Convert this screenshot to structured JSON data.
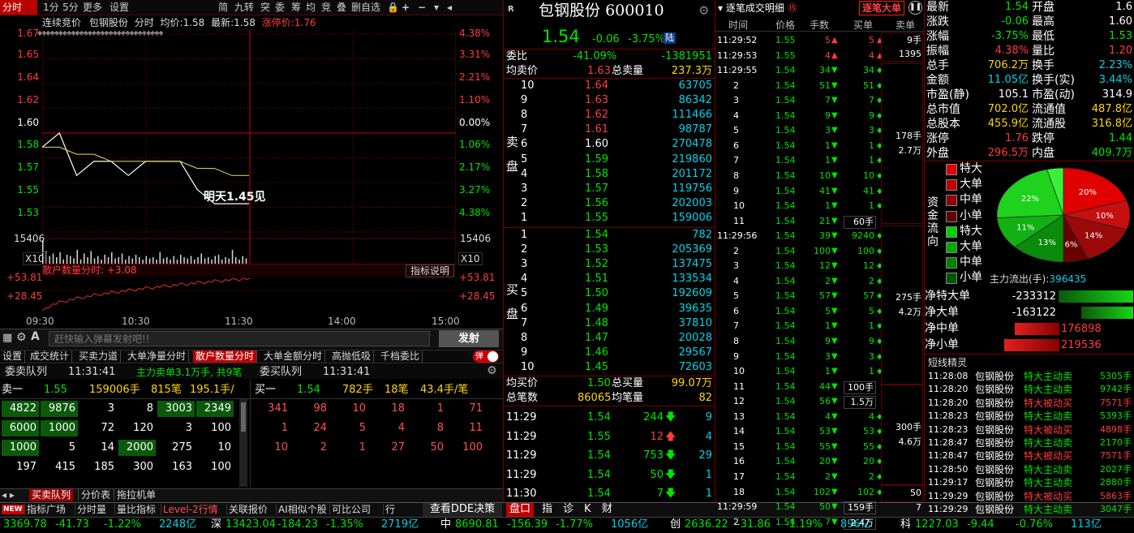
{
  "toolbar": {
    "tabs": [
      "分时",
      "1分",
      "5分",
      "更多",
      "设置"
    ],
    "right_tabs": [
      "简",
      "九转",
      "突",
      "委",
      "筹",
      "均",
      "竞",
      "叠",
      "删自选"
    ],
    "icons": [
      "lock-icon",
      "plus-icon",
      "minus-icon",
      "chevron-down-icon"
    ]
  },
  "chart_header": {
    "mode": "连续竞价",
    "stock": "包钢股份",
    "view": "分时",
    "avg_label": "均价:",
    "avg": "1.58",
    "latest_label": "最新:",
    "latest": "1.58",
    "limit_label": "涨停价:",
    "limit": "1.76"
  },
  "price_axis": {
    "left": [
      "1.67",
      "1.65",
      "1.64",
      "1.62",
      "1.60",
      "1.58",
      "1.57",
      "1.55",
      "1.53"
    ],
    "right": [
      "4.38%",
      "3.31%",
      "2.21%",
      "1.10%",
      "0.00%",
      "1.06%",
      "2.17%",
      "3.27%",
      "4.38%"
    ]
  },
  "volume_axis": {
    "left_value": "15406",
    "right_value": "15406",
    "left_unit": "X10",
    "right_unit": "X10"
  },
  "annotation": "明天1.45见",
  "indicator": {
    "title": "散户数量分时:",
    "value": "+3.08",
    "button": "指标说明",
    "left_top": "+53.81",
    "left_mid": "+28.45",
    "right_top": "+53.81",
    "right_mid": "+28.45"
  },
  "time_axis": [
    "09:30",
    "10:30",
    "11:30",
    "14:00",
    "15:00"
  ],
  "chart_data": {
    "type": "line",
    "title": "连续竞价 包钢股份 分时",
    "x": [
      "09:30",
      "09:40",
      "09:50",
      "10:00",
      "10:10",
      "10:20",
      "10:30",
      "10:40",
      "10:50",
      "11:00",
      "11:10",
      "11:20",
      "11:30"
    ],
    "series": [
      {
        "name": "最新",
        "values": [
          1.59,
          1.6,
          1.57,
          1.58,
          1.58,
          1.57,
          1.58,
          1.58,
          1.58,
          1.56,
          1.55,
          1.55,
          1.55
        ]
      },
      {
        "name": "均价",
        "values": [
          1.59,
          1.59,
          1.585,
          1.585,
          1.58,
          1.58,
          1.58,
          1.58,
          1.58,
          1.575,
          1.575,
          1.57,
          1.57
        ]
      }
    ],
    "ylim": [
      1.53,
      1.67
    ],
    "pre_close": 1.6,
    "volume_max": 15406
  },
  "danmu": {
    "placeholder": "赶快输入弹幕发射吧!!",
    "send": "发射"
  },
  "subtabs": [
    "设置",
    "成交统计",
    "买卖力道",
    "大单净量分时",
    "散户数量分时",
    "大单金额分时",
    "高抛低吸",
    "千档委比"
  ],
  "subtab_toggle": "弹",
  "queue": {
    "sell_title": "委卖队列",
    "sell_time": "11:31:41",
    "info": "主力卖单3.1万手, 共9笔",
    "buy_title": "委买队列",
    "buy_time": "11:31:41",
    "sell_row": {
      "label": "卖一",
      "price": "1.55",
      "vol": "159006手",
      "count": "815笔",
      "avg": "195.1手/"
    },
    "buy_row": {
      "label": "买一",
      "price": "1.54",
      "vol": "782手",
      "count": "18笔",
      "avg": "43.4手/笔"
    },
    "sell_cells": [
      [
        "4822",
        "9876",
        "3",
        "8",
        "3003",
        "2349"
      ],
      [
        "6000",
        "1000",
        "72",
        "120",
        "3",
        "100"
      ],
      [
        "1000",
        "5",
        "14",
        "2000",
        "275",
        "10"
      ],
      [
        "197",
        "415",
        "185",
        "300",
        "163",
        "100"
      ]
    ],
    "buy_cells": [
      [
        "341",
        "98",
        "10",
        "18",
        "1",
        "71"
      ],
      [
        "1",
        "24",
        "5",
        "4",
        "8",
        "11"
      ],
      [
        "10",
        "2",
        "1",
        "27",
        "50",
        "100"
      ]
    ]
  },
  "bottom_tabs": [
    "买卖队列",
    "分价表",
    "拖拉机单"
  ],
  "status": {
    "new": "NEW",
    "items": [
      "指标广场",
      "分时量",
      "量比指标",
      "Level-2行情",
      "关联报价",
      "AI相似个股",
      "可比公司",
      "行"
    ],
    "dde": "查看DDE决策",
    "right_tabs": [
      "盘口",
      "指",
      "诊",
      "K",
      "财"
    ]
  },
  "ticker": {
    "items": [
      {
        "name": "",
        "value": "3369.78",
        "change": "-41.73",
        "pct": "-1.22%",
        "amount": "2248亿"
      },
      {
        "name": "深",
        "value": "13423.04",
        "change": "-184.23",
        "pct": "-1.35%",
        "amount": "2719亿"
      },
      {
        "name": "中",
        "value": "8690.81",
        "change": "-156.39",
        "pct": "-1.77%",
        "amount": "1056亿"
      },
      {
        "name": "创",
        "value": "2636.22",
        "change": "-31.86",
        "pct": "-1.19%",
        "amount": "896亿"
      },
      {
        "name": "科",
        "value": "1227.03",
        "change": "-9.44",
        "pct": "-0.76%",
        "amount": "113亿"
      }
    ]
  },
  "quote": {
    "badge": "R",
    "name": "包钢股份",
    "code": "600010",
    "price": "1.54",
    "change": "-0.06",
    "pct": "-3.75%",
    "market": "陆",
    "webi_label": "委比",
    "webi": "-41.09%",
    "weicha": "-1381951",
    "avg_sell_label": "均卖价",
    "avg_sell": "1.63",
    "total_sell_label": "总卖量",
    "total_sell": "237.3万",
    "sell_side": "卖盘",
    "buy_side": "买盘",
    "asks": [
      {
        "n": "10",
        "p": "1.64",
        "v": "63705"
      },
      {
        "n": "9",
        "p": "1.63",
        "v": "86342"
      },
      {
        "n": "8",
        "p": "1.62",
        "v": "111466"
      },
      {
        "n": "7",
        "p": "1.61",
        "v": "98787"
      },
      {
        "n": "6",
        "p": "1.60",
        "v": "270478"
      },
      {
        "n": "5",
        "p": "1.59",
        "v": "219860"
      },
      {
        "n": "4",
        "p": "1.58",
        "v": "201172"
      },
      {
        "n": "3",
        "p": "1.57",
        "v": "119756"
      },
      {
        "n": "2",
        "p": "1.56",
        "v": "202003"
      },
      {
        "n": "1",
        "p": "1.55",
        "v": "159006"
      }
    ],
    "bids": [
      {
        "n": "1",
        "p": "1.54",
        "v": "782"
      },
      {
        "n": "2",
        "p": "1.53",
        "v": "205369"
      },
      {
        "n": "3",
        "p": "1.52",
        "v": "137475"
      },
      {
        "n": "4",
        "p": "1.51",
        "v": "133534"
      },
      {
        "n": "5",
        "p": "1.50",
        "v": "192609"
      },
      {
        "n": "6",
        "p": "1.49",
        "v": "39635"
      },
      {
        "n": "7",
        "p": "1.48",
        "v": "37810"
      },
      {
        "n": "8",
        "p": "1.47",
        "v": "20028"
      },
      {
        "n": "9",
        "p": "1.46",
        "v": "29567"
      },
      {
        "n": "10",
        "p": "1.45",
        "v": "72603"
      }
    ],
    "avg_buy_label": "均买价",
    "avg_buy": "1.50",
    "total_buy_label": "总买量",
    "total_buy": "99.07万",
    "total_count_label": "总笔数",
    "total_count": "86065",
    "avg_vol_label": "均笔量",
    "avg_vol": "82",
    "trades": [
      {
        "t": "11:29",
        "p": "1.54",
        "v": "244",
        "dir": "down",
        "n": "9"
      },
      {
        "t": "11:29",
        "p": "1.55",
        "v": "12",
        "dir": "up",
        "n": "4"
      },
      {
        "t": "11:29",
        "p": "1.54",
        "v": "753",
        "dir": "down",
        "n": "29"
      },
      {
        "t": "11:29",
        "p": "1.54",
        "v": "50",
        "dir": "down",
        "n": "1"
      },
      {
        "t": "11:30",
        "p": "1.54",
        "v": "7",
        "dir": "down",
        "n": "1"
      }
    ]
  },
  "ticks": {
    "dropdown": "逐笔成交明细",
    "badge": "⑮",
    "big_btn": "逐笔大单",
    "headers": [
      "时间",
      "价格",
      "手数",
      "买单",
      "卖单"
    ],
    "rows": [
      {
        "t": "11:29:52",
        "p": "1.55",
        "v": "5",
        "d": "up",
        "b": "5"
      },
      {
        "t": "11:29:53",
        "p": "1.55",
        "v": "4",
        "d": "up",
        "b": "4"
      },
      {
        "t": "11:29:55",
        "p": "1.54",
        "v": "34",
        "d": "down",
        "b": "34"
      },
      {
        "t": "2",
        "p": "1.54",
        "v": "51",
        "d": "down",
        "b": "51"
      },
      {
        "t": "3",
        "p": "1.54",
        "v": "7",
        "d": "down",
        "b": "7"
      },
      {
        "t": "4",
        "p": "1.54",
        "v": "9",
        "d": "down",
        "b": "9"
      },
      {
        "t": "5",
        "p": "1.54",
        "v": "3",
        "d": "down",
        "b": "3"
      },
      {
        "t": "6",
        "p": "1.54",
        "v": "1",
        "d": "down",
        "b": "1"
      },
      {
        "t": "7",
        "p": "1.54",
        "v": "1",
        "d": "down",
        "b": "1"
      },
      {
        "t": "8",
        "p": "1.54",
        "v": "10",
        "d": "down",
        "b": "10"
      },
      {
        "t": "9",
        "p": "1.54",
        "v": "41",
        "d": "down",
        "b": "41"
      },
      {
        "t": "10",
        "p": "1.54",
        "v": "1",
        "d": "down",
        "b": "1"
      },
      {
        "t": "11",
        "p": "1.54",
        "v": "21",
        "d": "down",
        "b": "60手"
      },
      {
        "t": "11:29:56",
        "p": "1.54",
        "v": "39",
        "d": "down",
        "b": "9240"
      },
      {
        "t": "2",
        "p": "1.54",
        "v": "100",
        "d": "down",
        "b": "100"
      },
      {
        "t": "3",
        "p": "1.54",
        "v": "12",
        "d": "down",
        "b": "12"
      },
      {
        "t": "4",
        "p": "1.54",
        "v": "2",
        "d": "down",
        "b": "2"
      },
      {
        "t": "5",
        "p": "1.54",
        "v": "57",
        "d": "down",
        "b": "57"
      },
      {
        "t": "6",
        "p": "1.54",
        "v": "5",
        "d": "down",
        "b": "5"
      },
      {
        "t": "7",
        "p": "1.54",
        "v": "1",
        "d": "down",
        "b": "1"
      },
      {
        "t": "8",
        "p": "1.54",
        "v": "9",
        "d": "down",
        "b": "9"
      },
      {
        "t": "9",
        "p": "1.54",
        "v": "3",
        "d": "down",
        "b": "3"
      },
      {
        "t": "10",
        "p": "1.54",
        "v": "1",
        "d": "down",
        "b": "1"
      },
      {
        "t": "11",
        "p": "1.54",
        "v": "44",
        "d": "down",
        "b": "100手"
      },
      {
        "t": "12",
        "p": "1.54",
        "v": "56",
        "d": "down",
        "b": "1.5万"
      },
      {
        "t": "13",
        "p": "1.54",
        "v": "4",
        "d": "down",
        "b": "4"
      },
      {
        "t": "14",
        "p": "1.54",
        "v": "53",
        "d": "down",
        "b": "53"
      },
      {
        "t": "15",
        "p": "1.54",
        "v": "55",
        "d": "down",
        "b": "55"
      },
      {
        "t": "16",
        "p": "1.54",
        "v": "20",
        "d": "down",
        "b": "20"
      },
      {
        "t": "17",
        "p": "1.54",
        "v": "2",
        "d": "down",
        "b": "2"
      },
      {
        "t": "18",
        "p": "1.54",
        "v": "102",
        "d": "down",
        "b": "102"
      },
      {
        "t": "11:29:59",
        "p": "1.54",
        "v": "50",
        "d": "down",
        "b": "159手"
      },
      {
        "t": "2",
        "p": "1.54",
        "v": "7",
        "d": "down",
        "b": "2.4万"
      }
    ],
    "sell_blocks": [
      {
        "top": "9手",
        "bot": "1395"
      },
      {
        "top": "178手",
        "bot": "2.7万"
      },
      {
        "top": "275手",
        "bot": "4.2万"
      },
      {
        "top": "300手",
        "bot": "4.6万"
      },
      {
        "top": "50",
        "bot": "7"
      }
    ]
  },
  "stats": {
    "left": [
      {
        "l": "最新",
        "v": "1.54",
        "c": "g"
      },
      {
        "l": "涨跌",
        "v": "-0.06",
        "c": "g"
      },
      {
        "l": "涨幅",
        "v": "-3.75%",
        "c": "g"
      },
      {
        "l": "振幅",
        "v": "4.38%",
        "c": "r"
      },
      {
        "l": "总手",
        "v": "706.2万",
        "c": "y"
      },
      {
        "l": "金额",
        "v": "11.05亿",
        "c": "c"
      },
      {
        "l": "市盈(静)",
        "v": "105.1",
        "c": "w"
      },
      {
        "l": "总市值",
        "v": "702.0亿",
        "c": "y"
      },
      {
        "l": "总股本",
        "v": "455.9亿",
        "c": "y"
      },
      {
        "l": "涨停",
        "v": "1.76",
        "c": "r"
      },
      {
        "l": "外盘",
        "v": "296.5万",
        "c": "r"
      }
    ],
    "right": [
      {
        "l": "开盘",
        "v": "1.6",
        "c": "w"
      },
      {
        "l": "最高",
        "v": "1.60",
        "c": "w"
      },
      {
        "l": "最低",
        "v": "1.53",
        "c": "g"
      },
      {
        "l": "量比",
        "v": "1.20",
        "c": "r"
      },
      {
        "l": "换手",
        "v": "2.23%",
        "c": "c"
      },
      {
        "l": "换手(实)",
        "v": "3.44%",
        "c": "c"
      },
      {
        "l": "市盈(动)",
        "v": "314.9",
        "c": "w"
      },
      {
        "l": "流通值",
        "v": "487.8亿",
        "c": "y"
      },
      {
        "l": "流通股",
        "v": "316.8亿",
        "c": "y"
      },
      {
        "l": "跌停",
        "v": "1.44",
        "c": "g"
      },
      {
        "l": "内盘",
        "v": "409.7万",
        "c": "g"
      }
    ]
  },
  "fund": {
    "side": "资金流向",
    "legend": [
      "特大",
      "大单",
      "中单",
      "小单",
      "特大",
      "大单",
      "中单",
      "小单"
    ],
    "legend_colors": [
      "#e00000",
      "#c00000",
      "#900000",
      "#600000",
      "#00d000",
      "#00a800",
      "#008000",
      "#005500"
    ],
    "pie": [
      {
        "label": "20%",
        "value": 20,
        "color": "#e00000"
      },
      {
        "label": "10%",
        "value": 10,
        "color": "#c41010"
      },
      {
        "label": "14%",
        "value": 14,
        "color": "#9a0a0a"
      },
      {
        "label": "6%",
        "value": 6,
        "color": "#6a0000"
      },
      {
        "label": "13%",
        "value": 13,
        "color": "#0b8a0b"
      },
      {
        "label": "11%",
        "value": 11,
        "color": "#12b012"
      },
      {
        "label": "22%",
        "value": 22,
        "color": "#1ed21e"
      },
      {
        "label": "",
        "value": 4,
        "color": "#3aee3a"
      }
    ],
    "main_label": "主力流出(手):",
    "main_value": "396435",
    "net": [
      {
        "l": "净特大单",
        "v": "-233312",
        "c": "g",
        "frac": 1.0
      },
      {
        "l": "净大单",
        "v": "-163122",
        "c": "g",
        "frac": 0.7
      },
      {
        "l": "净中单",
        "v": "176898",
        "c": "r",
        "frac": 0.76
      },
      {
        "l": "净小单",
        "v": "219536",
        "c": "r",
        "frac": 0.94
      }
    ]
  },
  "alerts": {
    "title": "短线精灵",
    "rows": [
      {
        "t": "11:28:08",
        "s": "包钢股份",
        "e": "特大主动卖",
        "v": "5305手",
        "c": "g"
      },
      {
        "t": "11:28:20",
        "s": "包钢股份",
        "e": "特大主动卖",
        "v": "9742手",
        "c": "g"
      },
      {
        "t": "11:28:20",
        "s": "包钢股份",
        "e": "特大被动买",
        "v": "7571手",
        "c": "r"
      },
      {
        "t": "11:28:23",
        "s": "包钢股份",
        "e": "特大主动卖",
        "v": "5393手",
        "c": "g"
      },
      {
        "t": "11:28:23",
        "s": "包钢股份",
        "e": "特大被动买",
        "v": "4898手",
        "c": "r"
      },
      {
        "t": "11:28:47",
        "s": "包钢股份",
        "e": "特大主动卖",
        "v": "2170手",
        "c": "g"
      },
      {
        "t": "11:28:47",
        "s": "包钢股份",
        "e": "特大被动买",
        "v": "7571手",
        "c": "r"
      },
      {
        "t": "11:28:50",
        "s": "包钢股份",
        "e": "特大主动卖",
        "v": "2027手",
        "c": "g"
      },
      {
        "t": "11:29:17",
        "s": "包钢股份",
        "e": "特大主动卖",
        "v": "2880手",
        "c": "g"
      },
      {
        "t": "11:29:29",
        "s": "包钢股份",
        "e": "特大被动买",
        "v": "5863手",
        "c": "r"
      },
      {
        "t": "11:29:29",
        "s": "包钢股份",
        "e": "特大主动卖",
        "v": "3047手",
        "c": "g"
      }
    ]
  }
}
